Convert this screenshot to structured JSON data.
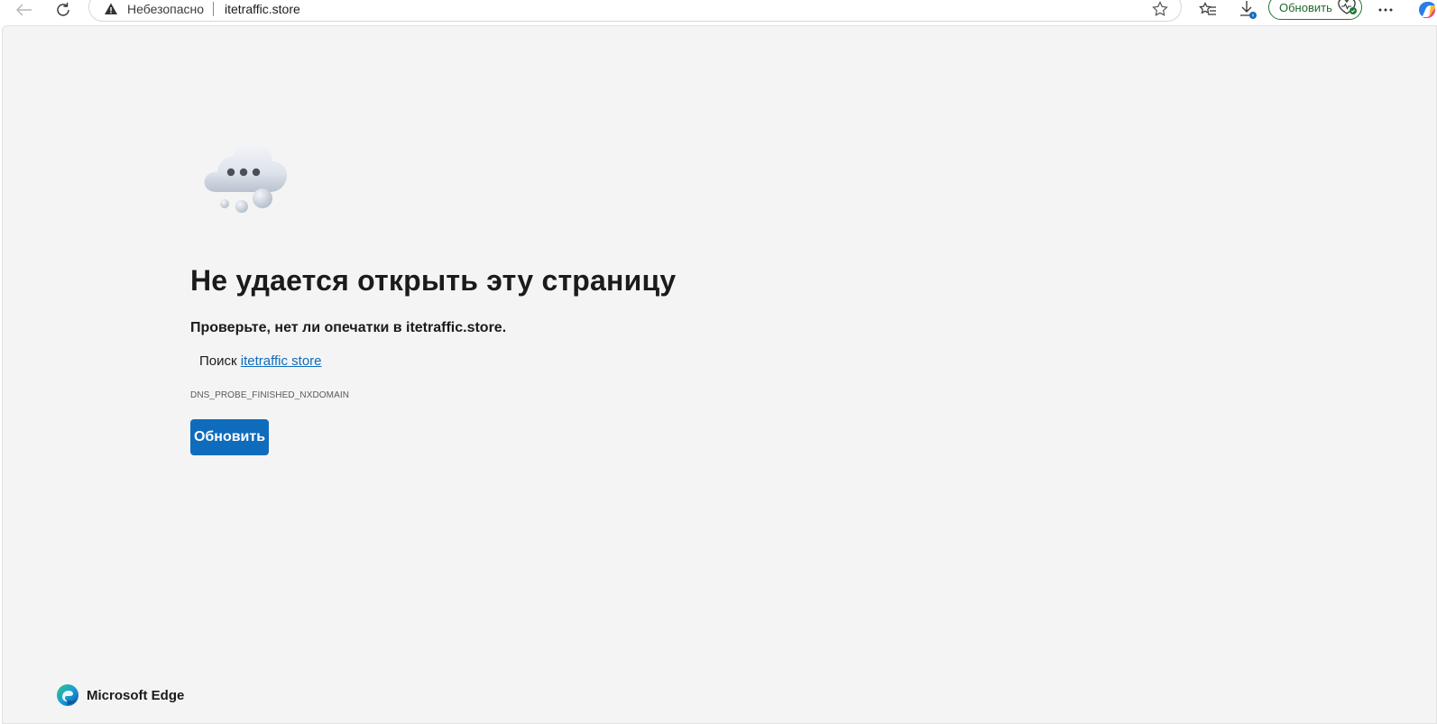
{
  "browser": {
    "address_bar": {
      "security_label": "Небезопасно",
      "url": "itetraffic.store"
    },
    "update_button_label": "Обновить",
    "icons": [
      "back-icon",
      "refresh-icon",
      "warning-icon",
      "star-icon",
      "favorites-icon",
      "download-icon",
      "heart-health-icon",
      "more-icon",
      "copilot-icon"
    ]
  },
  "error_page": {
    "title": "Не удается открыть эту страницу",
    "check_message": "Проверьте, нет ли опечатки в itetraffic.store.",
    "search_prefix": "Поиск",
    "search_link": "itetraffic store",
    "error_code": "DNS_PROBE_FINISHED_NXDOMAIN",
    "refresh_button": "Обновить",
    "illustration": "thinking-cloud-icon"
  },
  "footer": {
    "brand_name": "Microsoft Edge"
  },
  "colors": {
    "accent": "#0f6cbd",
    "page_background": "#f4f4f4",
    "update_green": "#1d7a34"
  }
}
